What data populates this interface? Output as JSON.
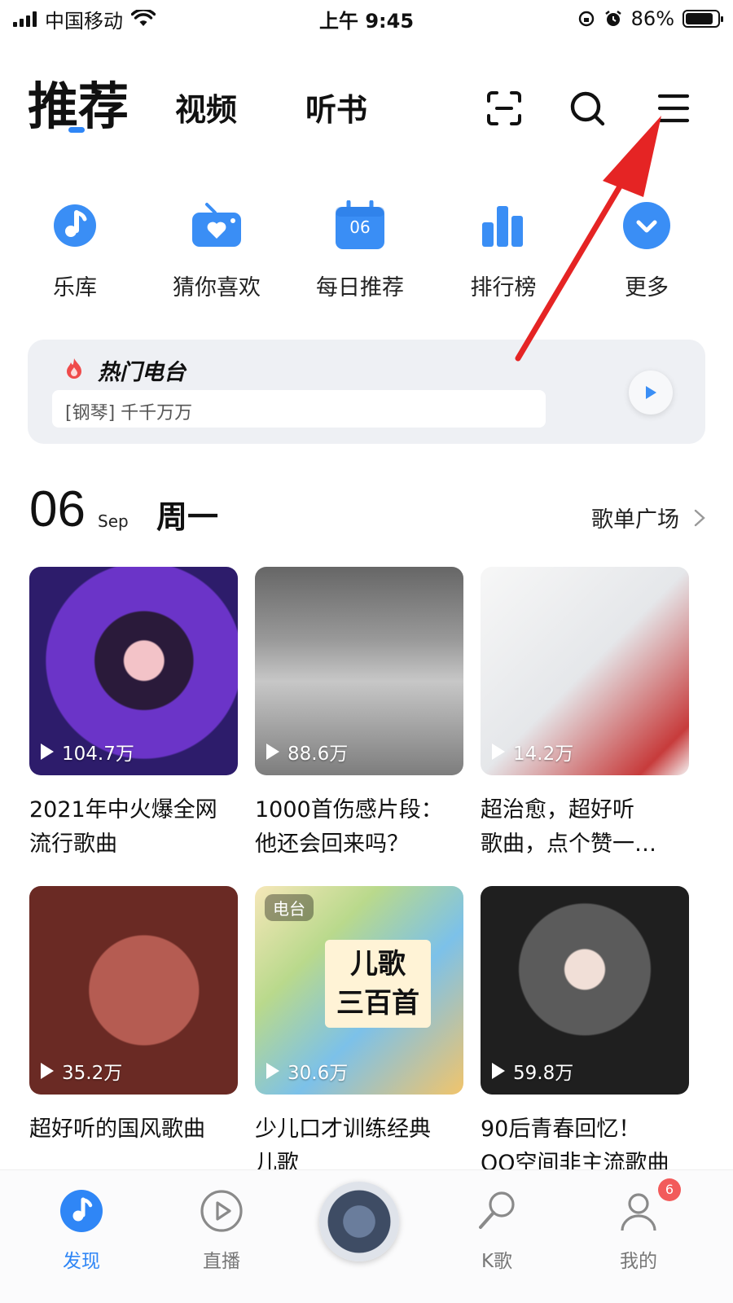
{
  "status_bar": {
    "carrier": "中国移动",
    "time": "上午 9:45",
    "battery": "86%",
    "battery_level": 0.86
  },
  "header": {
    "tabs": [
      "推荐",
      "视频",
      "听书"
    ],
    "icons": [
      "scan-icon",
      "search-icon",
      "menu-icon"
    ]
  },
  "quick_entries": [
    {
      "label": "乐库",
      "icon": "music-note-icon"
    },
    {
      "label": "猜你喜欢",
      "icon": "heart-radio-icon"
    },
    {
      "label": "每日推荐",
      "icon": "calendar-icon",
      "icon_text": "06"
    },
    {
      "label": "排行榜",
      "icon": "bar-chart-icon"
    },
    {
      "label": "更多",
      "icon": "chevron-down-circle-icon"
    }
  ],
  "hot_radio": {
    "title": "热门电台",
    "current": "[钢琴] 千千万万"
  },
  "date_header": {
    "day": "06",
    "month": "Sep",
    "weekday": "周一",
    "plaza_link": "歌单广场"
  },
  "playlists": [
    {
      "count": "104.7万",
      "title_line1": "2021年中火爆全网",
      "title_line2": "流行歌曲"
    },
    {
      "count": "88.6万",
      "title_line1": "1000首伤感片段：",
      "title_line2": "他还会回来吗？"
    },
    {
      "count": "14.2万",
      "title_line1": "超治愈，超好听",
      "title_line2": "歌曲，点个赞一…"
    },
    {
      "count": "35.2万",
      "title_line1": "超好听的国风歌曲",
      "title_line2": ""
    },
    {
      "count": "30.6万",
      "title_line1": "少儿口才训练经典",
      "title_line2": "儿歌",
      "badge": "电台",
      "cover_text_1": "儿歌",
      "cover_text_2": "三百首"
    },
    {
      "count": "59.8万",
      "title_line1": "90后青春回忆！",
      "title_line2": "QQ空间非主流歌曲"
    }
  ],
  "bottom_nav": {
    "items": [
      "发现",
      "直播",
      "",
      "K歌",
      "我的"
    ],
    "badge": "6"
  },
  "colors": {
    "accent": "#2f86f6",
    "annotation": "#e52424"
  }
}
